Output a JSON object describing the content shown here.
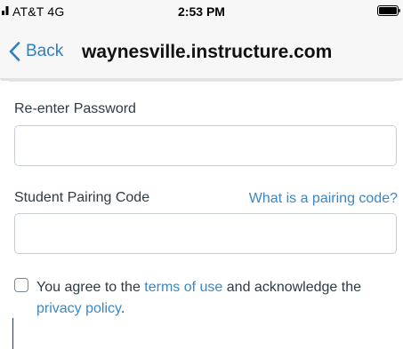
{
  "status_bar": {
    "carrier": "AT&T  4G",
    "time": "2:53 PM",
    "icons": [
      "signal-icon",
      "battery-icon"
    ]
  },
  "nav": {
    "back_label": "Back",
    "title": "waynesville.instructure.com",
    "accent_color": "#2f80c4"
  },
  "form": {
    "reenter_password": {
      "label": "Re-enter Password",
      "value": "",
      "placeholder": ""
    },
    "pairing_code": {
      "label": "Student Pairing Code",
      "help_link": "What is a pairing code?",
      "value": "",
      "placeholder": ""
    },
    "agreement": {
      "checked": false,
      "text_prefix": "You agree to the ",
      "terms_link": "terms of use",
      "text_middle": " and acknowledge the ",
      "privacy_link": "privacy policy",
      "text_suffix": "."
    }
  },
  "colors": {
    "link": "#3a87c7",
    "text": "#2d3b45",
    "input_border": "#c7cdd1"
  }
}
